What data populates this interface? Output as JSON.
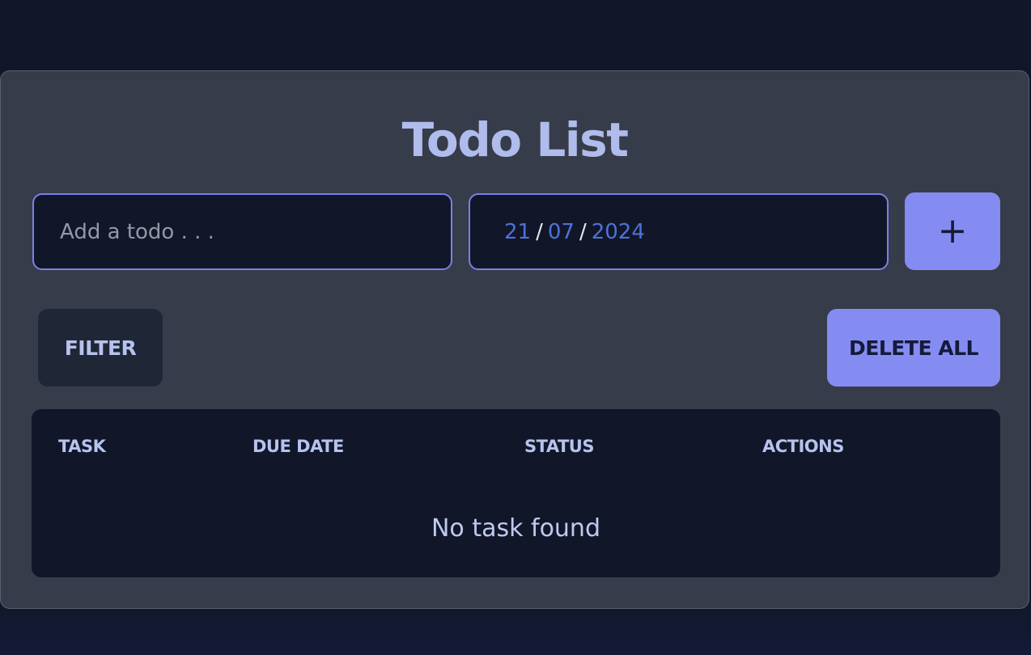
{
  "app": {
    "title": "Todo List"
  },
  "form": {
    "todo_placeholder": "Add a todo . . .",
    "todo_value": "",
    "date": {
      "day": "21",
      "month": "07",
      "year": "2024",
      "separator": "/"
    },
    "add_label": "+"
  },
  "toolbar": {
    "filter_label": "FILTER",
    "delete_all_label": "DELETE ALL"
  },
  "table": {
    "headers": [
      "TASK",
      "DUE DATE",
      "STATUS",
      "ACTIONS"
    ],
    "rows": [],
    "empty_message": "No task found"
  },
  "colors": {
    "background": "#111729",
    "card": "#373c4a",
    "accent": "#858cf1",
    "title": "#b0bcec",
    "date_text": "#4f71d8"
  }
}
